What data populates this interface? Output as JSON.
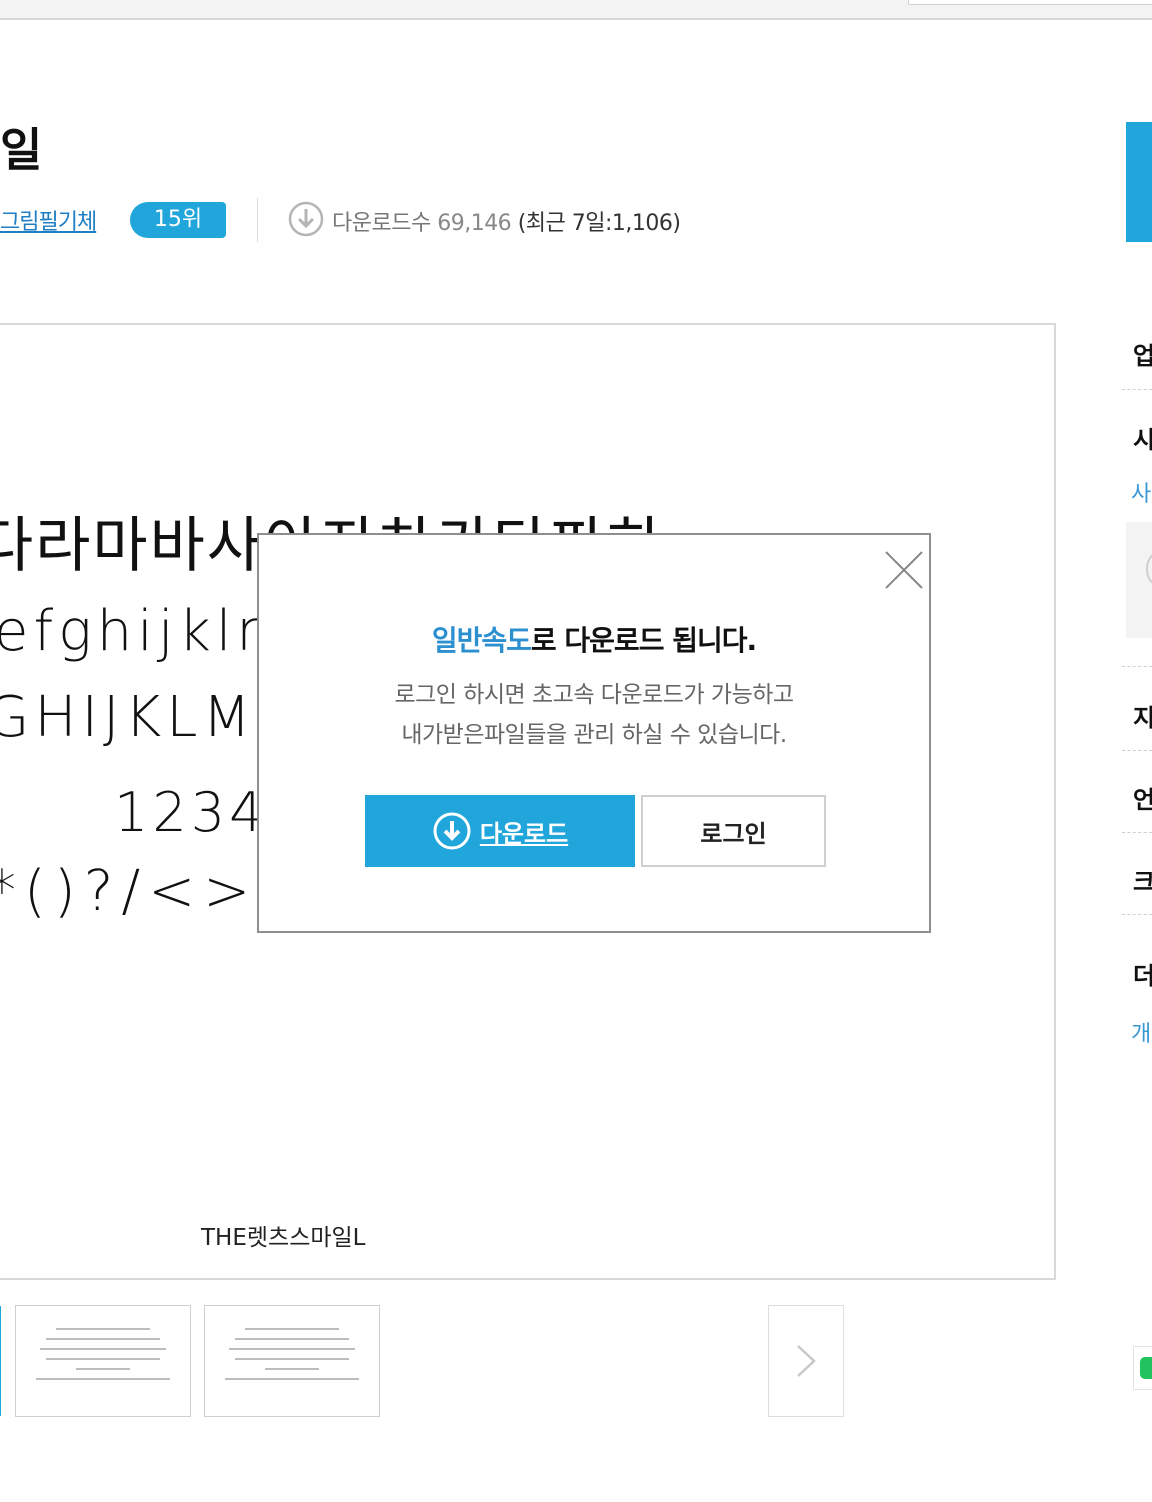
{
  "colors": {
    "accent": "#21a6dc",
    "link": "#2b8fd0"
  },
  "header": {
    "title": "일",
    "category": "그림필기체",
    "rank": "15위",
    "download_label": "다운로드수",
    "download_count": "69,146",
    "recent": "(최근 7일:1,106)"
  },
  "preview": {
    "lines": [
      "다라마바사아자차카타파하",
      "efghijklmnopqrstuvwxyz",
      "GHIJKLMNOPQRSTUVWXYZ",
      "1234567890",
      "*()?/<>,.:;'\"-_=+"
    ],
    "caption": "THE렛츠스마일L"
  },
  "modal": {
    "heading_highlight": "일반속도",
    "heading_rest": "로 다운로드 됩니다.",
    "desc_line1": "로그인 하시면 초고속 다운로드가 가능하고",
    "desc_line2": "내가받은파일들을 관리 하실 수 있습니다.",
    "download_button": "다운로드",
    "login_button": "로그인"
  },
  "sidebar": {
    "labels": [
      "업",
      "시",
      "지",
      "언",
      "크",
      "더"
    ],
    "links": [
      "사",
      "개"
    ]
  },
  "icons": {
    "download": "download-circle-icon",
    "close": "close-icon",
    "next": "chevron-right-icon"
  }
}
